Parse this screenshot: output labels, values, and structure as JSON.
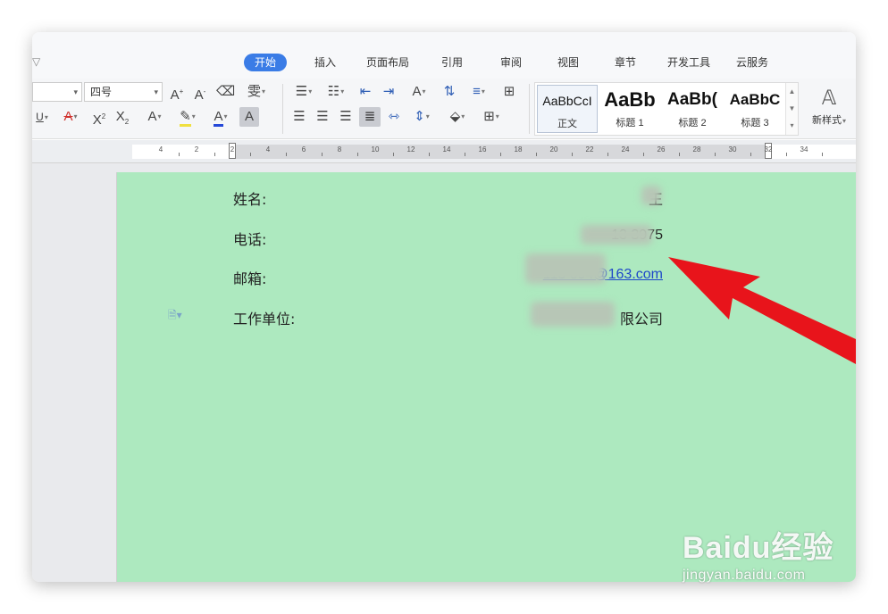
{
  "tabs": [
    {
      "label": "开始",
      "active": true
    },
    {
      "label": "插入"
    },
    {
      "label": "页面布局"
    },
    {
      "label": "引用"
    },
    {
      "label": "审阅"
    },
    {
      "label": "视图"
    },
    {
      "label": "章节"
    },
    {
      "label": "开发工具"
    },
    {
      "label": "云服务"
    }
  ],
  "font": {
    "size_value": "四号"
  },
  "styles": [
    {
      "sample": "AaBbCcI",
      "label": "正文",
      "selected": true
    },
    {
      "sample": "AaBb",
      "label": "标题 1"
    },
    {
      "sample": "AaBb(",
      "label": "标题 2"
    },
    {
      "sample": "AaBbC",
      "label": "标题 3"
    }
  ],
  "new_style_label": "新样式",
  "ruler_numbers": [
    "4",
    "2",
    "2",
    "4",
    "6",
    "8",
    "10",
    "12",
    "14",
    "16",
    "18",
    "20",
    "22",
    "24",
    "26",
    "28",
    "30",
    "32",
    "34"
  ],
  "document": {
    "page_color": "#ade9bf",
    "fields": [
      {
        "label": "姓名:",
        "value": "王"
      },
      {
        "label": "电话:",
        "value": "13      3975"
      },
      {
        "label": "邮箱:",
        "value": "113      894@163.com"
      },
      {
        "label": "工作单位:",
        "value": "限公司"
      }
    ]
  },
  "annotation": {
    "arrow_color": "#e8141b"
  },
  "watermark": {
    "brand": "Baidu经验",
    "url": "jingyan.baidu.com"
  },
  "colors": {
    "accent_tab": "#3a7ce6",
    "link": "#1d47c9"
  }
}
